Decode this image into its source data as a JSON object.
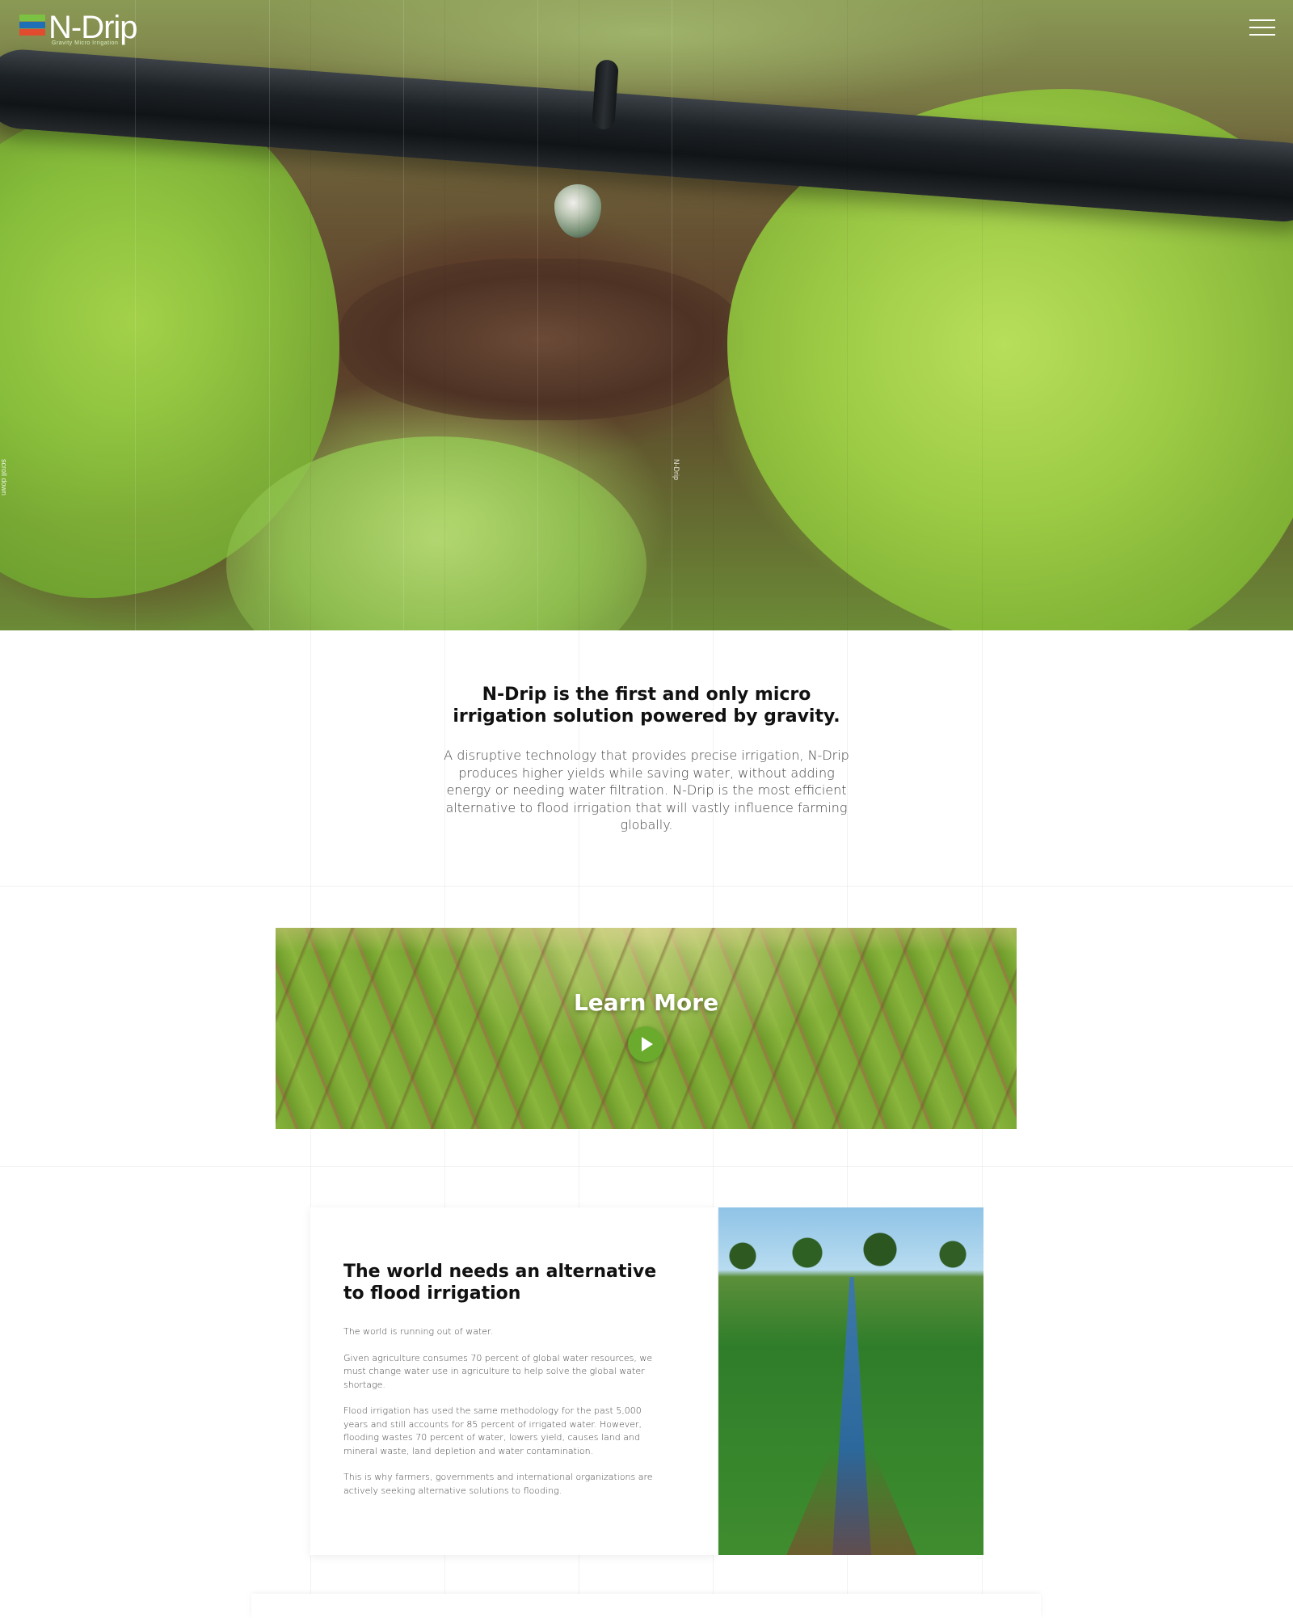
{
  "header": {
    "logo_text": "N-Drip",
    "logo_tagline": "Gravity Micro Irrigation",
    "menu_icon": "hamburger-icon"
  },
  "hero": {
    "side_label_left": "scroll down",
    "side_label_center": "N-Drip"
  },
  "intro": {
    "title": "N-Drip is the first and only micro irrigation solution powered by gravity.",
    "text": "A disruptive technology that provides precise irrigation, N-Drip produces higher yields while saving water, without adding energy or needing water filtration. N-Drip is the most efficient alternative to flood irrigation that will vastly influence farming globally."
  },
  "video_banner": {
    "label": "Learn More",
    "play_icon": "play-icon"
  },
  "alternative_section": {
    "title": "The world needs an alternative to flood irrigation",
    "paragraphs": [
      "The world is running out of water.",
      "Given agriculture consumes 70 percent of global water resources, we must change water use in agriculture to help solve the global water shortage.",
      "Flood irrigation has used the same methodology for the past 5,000 years and still accounts for 85 percent of irrigated water. However, flooding wastes 70 percent of water, lowers yield, causes land and mineral waste, land depletion and water contamination.",
      "This is why farmers, governments and international organizations are actively seeking alternative solutions to flooding."
    ]
  },
  "colors": {
    "accent": "#6aab2e",
    "heading": "#111111",
    "body_text": "#444444"
  }
}
